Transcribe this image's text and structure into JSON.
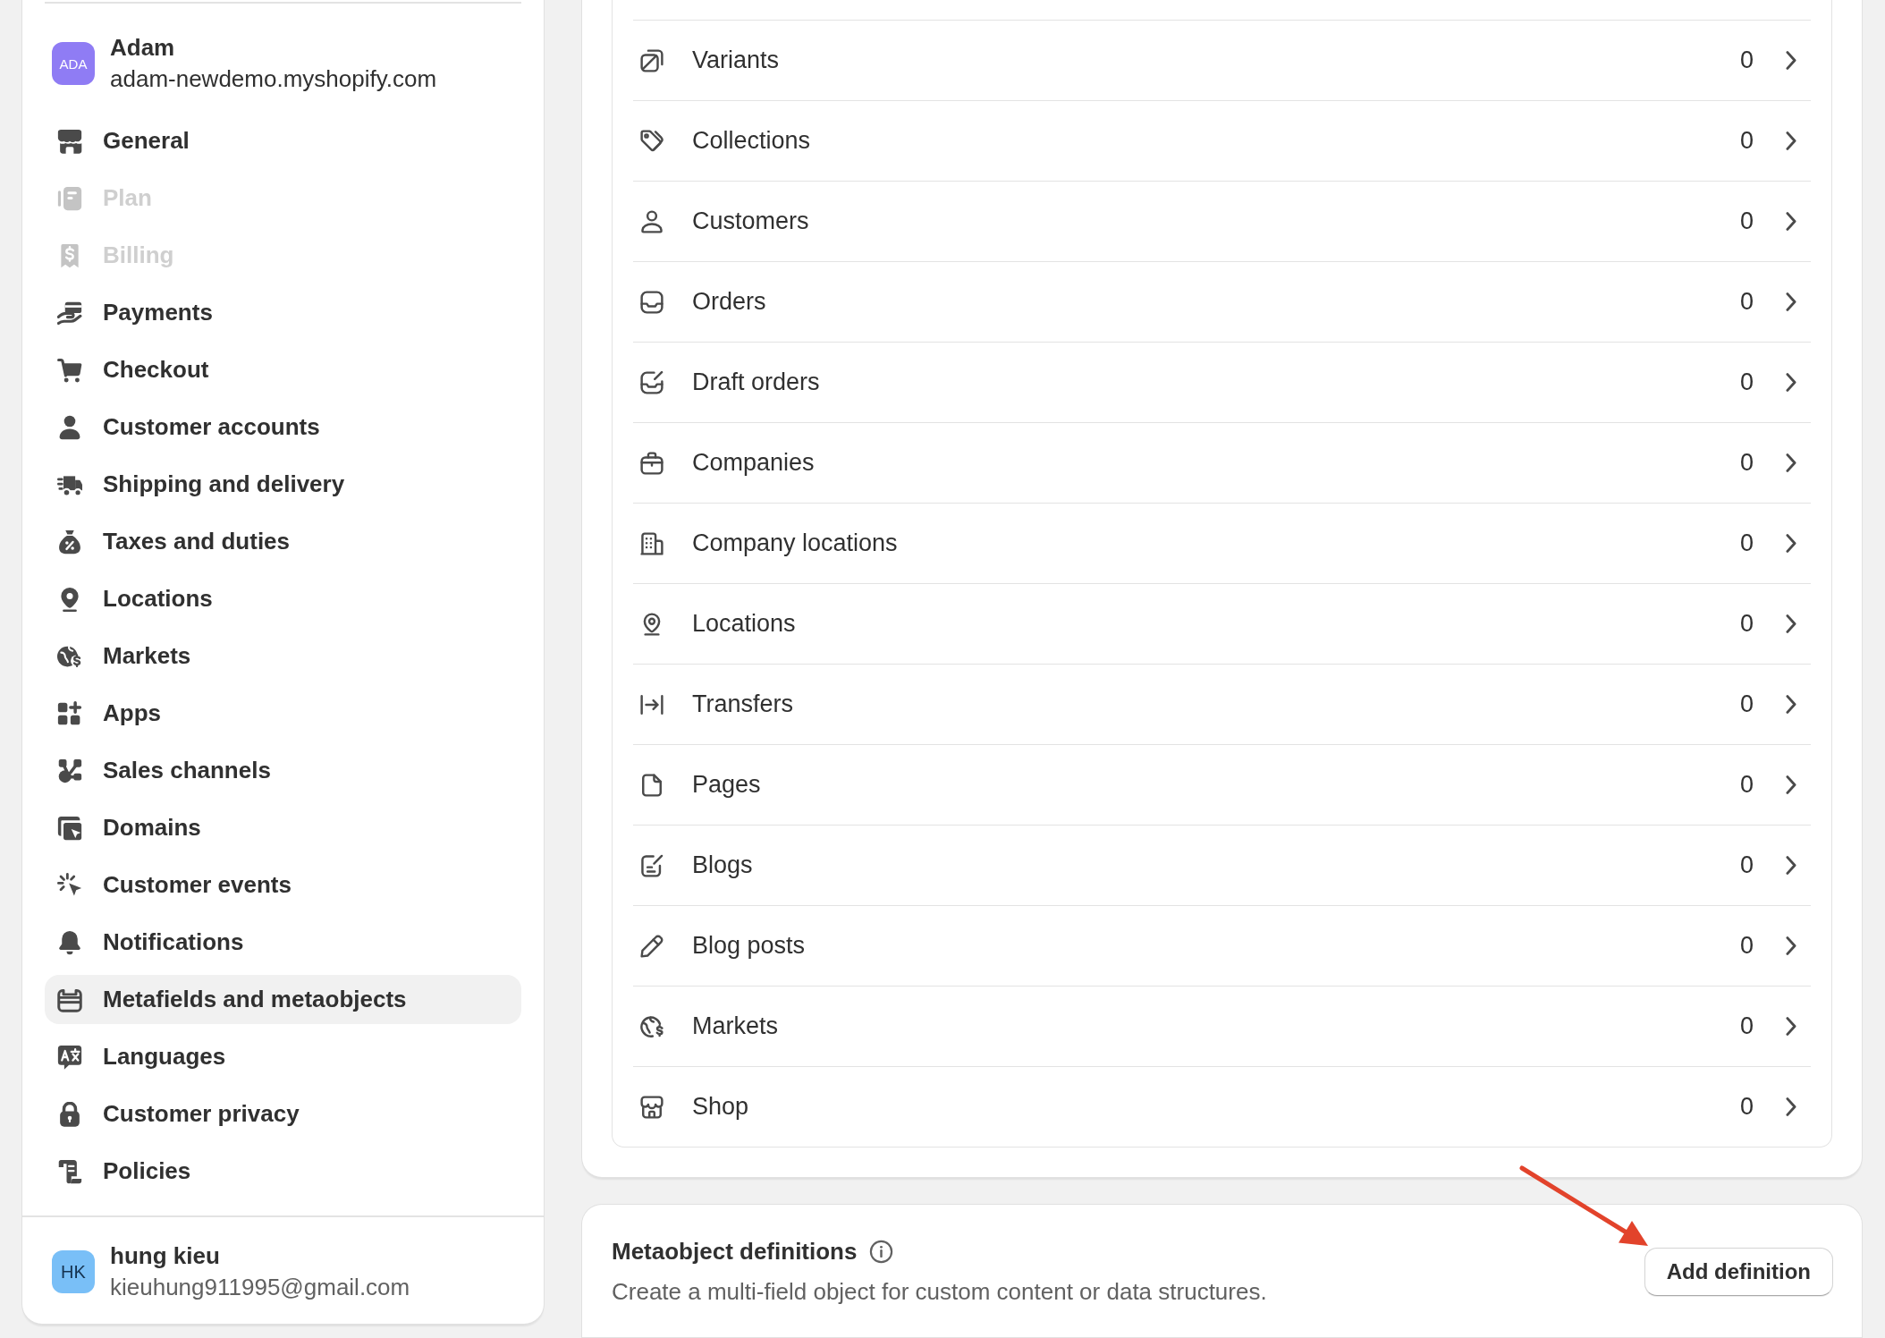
{
  "sidebar": {
    "store": {
      "avatar_initials": "ADA",
      "name": "Adam",
      "domain": "adam-newdemo.myshopify.com"
    },
    "items": [
      {
        "label": "General",
        "selected": false,
        "disabled": false
      },
      {
        "label": "Plan",
        "selected": false,
        "disabled": true
      },
      {
        "label": "Billing",
        "selected": false,
        "disabled": true
      },
      {
        "label": "Payments",
        "selected": false,
        "disabled": false
      },
      {
        "label": "Checkout",
        "selected": false,
        "disabled": false
      },
      {
        "label": "Customer accounts",
        "selected": false,
        "disabled": false
      },
      {
        "label": "Shipping and delivery",
        "selected": false,
        "disabled": false
      },
      {
        "label": "Taxes and duties",
        "selected": false,
        "disabled": false
      },
      {
        "label": "Locations",
        "selected": false,
        "disabled": false
      },
      {
        "label": "Markets",
        "selected": false,
        "disabled": false
      },
      {
        "label": "Apps",
        "selected": false,
        "disabled": false
      },
      {
        "label": "Sales channels",
        "selected": false,
        "disabled": false
      },
      {
        "label": "Domains",
        "selected": false,
        "disabled": false
      },
      {
        "label": "Customer events",
        "selected": false,
        "disabled": false
      },
      {
        "label": "Notifications",
        "selected": false,
        "disabled": false
      },
      {
        "label": "Metafields and metaobjects",
        "selected": true,
        "disabled": false
      },
      {
        "label": "Languages",
        "selected": false,
        "disabled": false
      },
      {
        "label": "Customer privacy",
        "selected": false,
        "disabled": false
      },
      {
        "label": "Policies",
        "selected": false,
        "disabled": false
      }
    ],
    "user": {
      "avatar_initials": "HK",
      "name": "hung kieu",
      "email": "kieuhung911995@gmail.com"
    }
  },
  "metafields": {
    "rows": [
      {
        "label": "Variants",
        "count": "0"
      },
      {
        "label": "Collections",
        "count": "0"
      },
      {
        "label": "Customers",
        "count": "0"
      },
      {
        "label": "Orders",
        "count": "0"
      },
      {
        "label": "Draft orders",
        "count": "0"
      },
      {
        "label": "Companies",
        "count": "0"
      },
      {
        "label": "Company locations",
        "count": "0"
      },
      {
        "label": "Locations",
        "count": "0"
      },
      {
        "label": "Transfers",
        "count": "0"
      },
      {
        "label": "Pages",
        "count": "0"
      },
      {
        "label": "Blogs",
        "count": "0"
      },
      {
        "label": "Blog posts",
        "count": "0"
      },
      {
        "label": "Markets",
        "count": "0"
      },
      {
        "label": "Shop",
        "count": "0"
      }
    ]
  },
  "metaobjects": {
    "title": "Metaobject definitions",
    "description": "Create a multi-field object for custom content or data structures.",
    "button": "Add definition"
  }
}
